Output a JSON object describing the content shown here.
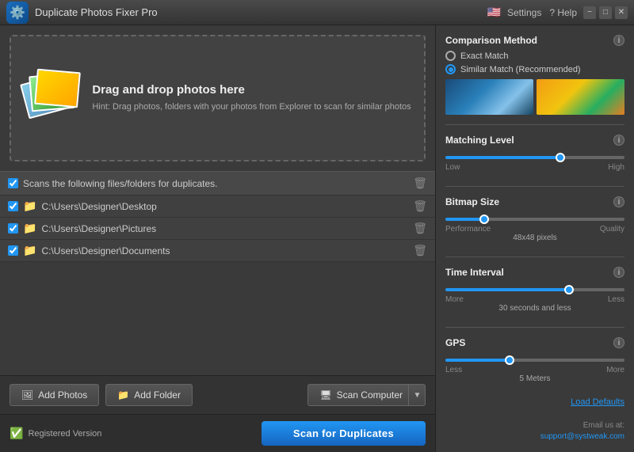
{
  "titleBar": {
    "title": "Duplicate Photos Fixer Pro",
    "menuItems": [
      "Settings",
      "? Help"
    ]
  },
  "dropZone": {
    "heading": "Drag and drop photos here",
    "hint": "Hint: Drag photos, folders with your photos from Explorer to scan for similar photos"
  },
  "folderList": {
    "headerLabel": "Scans the following files/folders for duplicates.",
    "folders": [
      "C:\\Users\\Designer\\Desktop",
      "C:\\Users\\Designer\\Pictures",
      "C:\\Users\\Designer\\Documents"
    ]
  },
  "buttons": {
    "addPhotos": "Add Photos",
    "addFolder": "Add Folder",
    "scanComputer": "Scan Computer",
    "scanForDuplicates": "Scan for Duplicates",
    "loadDefaults": "Load Defaults"
  },
  "status": {
    "registeredVersion": "Registered Version"
  },
  "rightPanel": {
    "comparisonMethod": {
      "label": "Comparison Method",
      "options": [
        "Exact Match",
        "Similar Match (Recommended)"
      ],
      "selected": 1
    },
    "matchingLevel": {
      "label": "Matching Level",
      "low": "Low",
      "high": "High",
      "value": 65
    },
    "bitmapSize": {
      "label": "Bitmap Size",
      "performance": "Performance",
      "quality": "Quality",
      "center": "48x48 pixels",
      "value": 20
    },
    "timeInterval": {
      "label": "Time Interval",
      "more": "More",
      "less": "Less",
      "center": "30 seconds and less",
      "value": 70
    },
    "gps": {
      "label": "GPS",
      "less": "Less",
      "more": "More",
      "center": "5 Meters",
      "value": 35
    },
    "email": {
      "label": "Email us at:",
      "address": "support@systweak.com"
    }
  }
}
